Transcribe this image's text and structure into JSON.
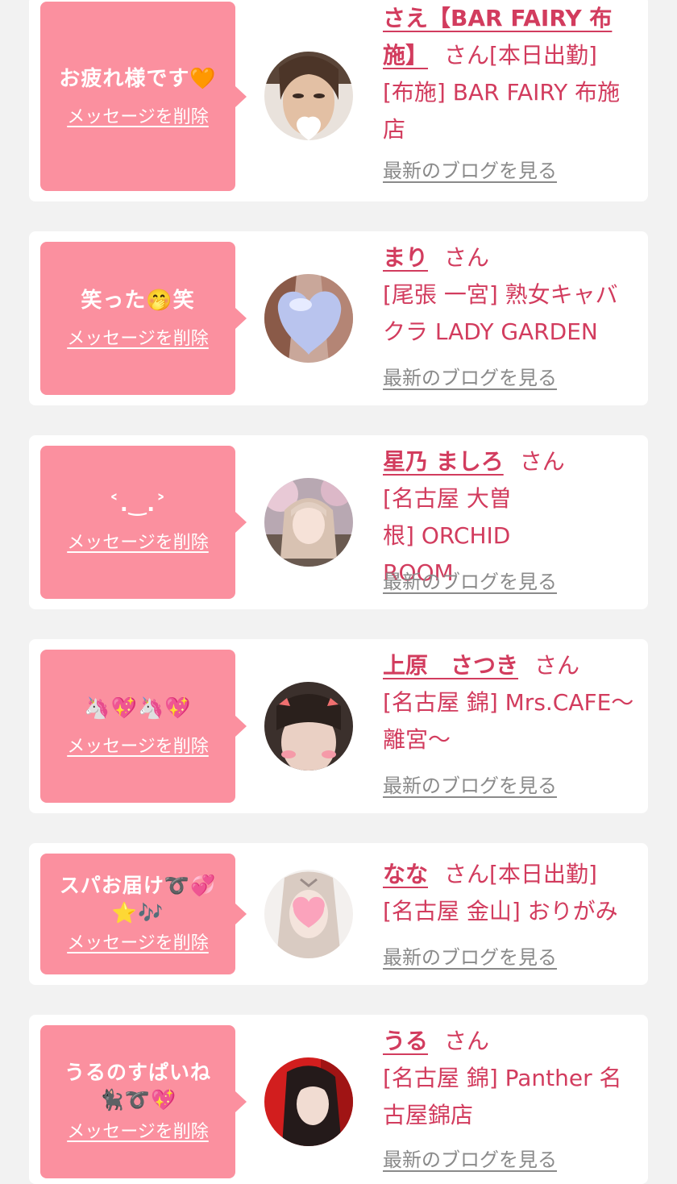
{
  "delete_label": "メッセージを削除",
  "blog_label": "最新のブログを見る",
  "honorific": "さん",
  "colors": {
    "accent": "#d23c5e",
    "bubble": "#fb909f",
    "card": "#ffffff",
    "background": "#f2f2f2",
    "link_gray": "#8a8a8a"
  },
  "entries": [
    {
      "message": "お疲れ様です🧡",
      "name": "さえ【BAR FAIRY 布施】",
      "status": "[本日出勤]",
      "shop": "[布施] BAR FAIRY 布施店",
      "avatar": "avatar-woman-heart-face"
    },
    {
      "message": "笑った🤭笑",
      "name": "まり",
      "status": "",
      "shop": "[尾張 一宮] 熟女キャバクラ LADY GARDEN",
      "avatar": "avatar-heart-cover"
    },
    {
      "message": "˂.‿.˃",
      "name": "星乃 ましろ",
      "status": "",
      "shop": "[名古屋 大曽根] ORCHID ROOM",
      "avatar": "avatar-blossom-photo"
    },
    {
      "message": "🦄💖🦄💖",
      "name": "上原　さつき",
      "status": "",
      "shop": "[名古屋 錦] Mrs.CAFE〜離宮〜",
      "avatar": "avatar-cat-ears"
    },
    {
      "message": "スパお届け➰💞⭐🎶",
      "name": "なな",
      "status": "[本日出勤]",
      "shop": "[名古屋 金山] おりがみ",
      "avatar": "avatar-heart-face"
    },
    {
      "message": "うるのすぱいね🐈‍⬛➰💖",
      "name": "うる",
      "status": "",
      "shop": "[名古屋 錦] Panther 名古屋錦店",
      "avatar": "avatar-red-background"
    }
  ]
}
